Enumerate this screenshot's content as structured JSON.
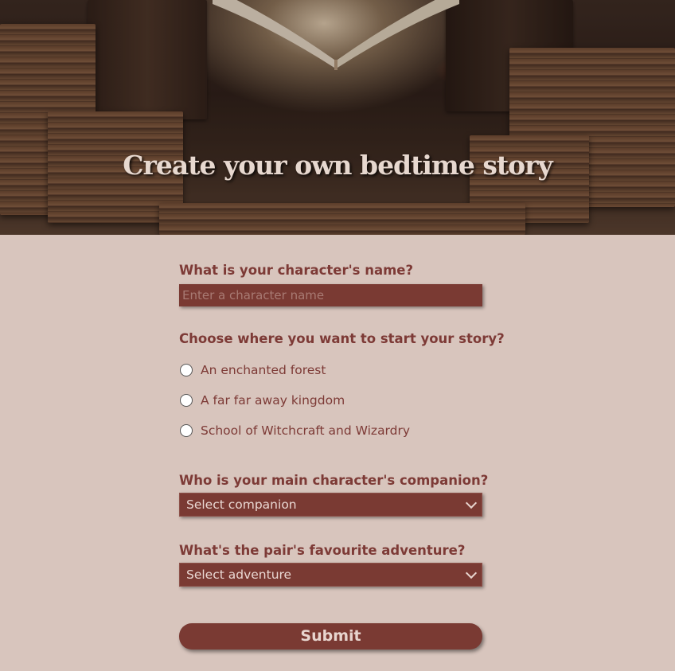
{
  "hero": {
    "title": "Create your own bedtime story"
  },
  "form": {
    "name_question": "What is your character's name?",
    "name_placeholder": "Enter a character name",
    "location_question": "Choose where you want to start your story?",
    "locations": [
      "An enchanted forest",
      "A far far away kingdom",
      "School of Witchcraft and Wizardry"
    ],
    "companion_question": "Who is your main character's companion?",
    "companion_selected": "Select companion",
    "adventure_question": "What's the pair's favourite adventure?",
    "adventure_selected": "Select adventure",
    "submit_label": "Submit"
  },
  "colors": {
    "page_background": "#d8c5bd",
    "accent": "#7a3a33",
    "label_text": "#7d3a36"
  },
  "icons": {
    "select_arrow": "chevron-down-icon"
  }
}
